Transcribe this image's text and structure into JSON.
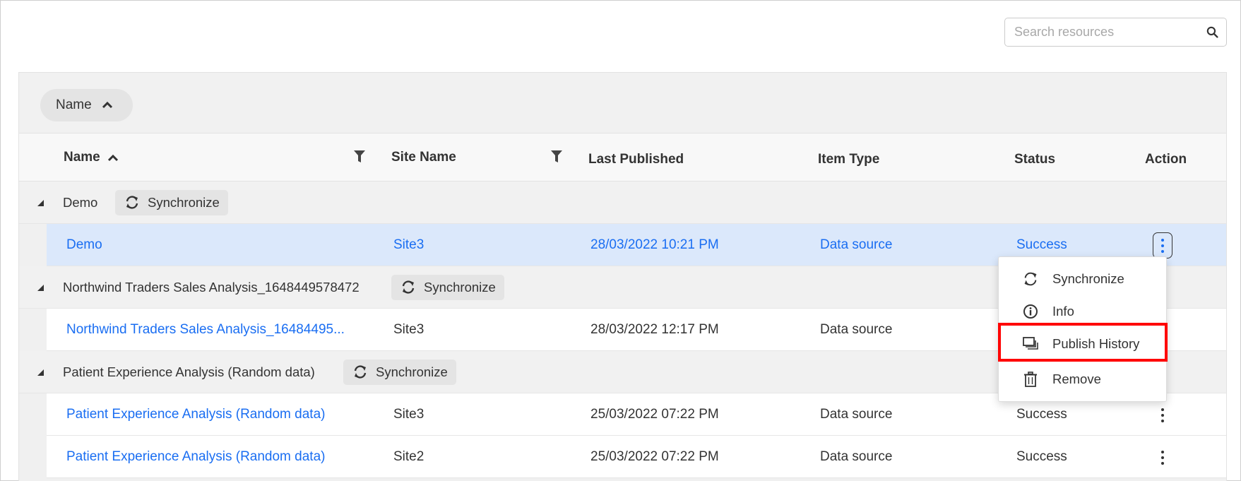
{
  "search": {
    "placeholder": "Search resources",
    "value": "",
    "icon": "search-icon"
  },
  "group_by": {
    "chip_label": "Name",
    "sort_icon": "chevron-up-icon"
  },
  "columns": [
    {
      "label": "Name",
      "sorted": "ascending",
      "filterable": true
    },
    {
      "label": "Site Name",
      "filterable": true
    },
    {
      "label": "Last Published"
    },
    {
      "label": "Item Type"
    },
    {
      "label": "Status"
    },
    {
      "label": "Action"
    }
  ],
  "groups": [
    {
      "name": "Demo",
      "sync_label": "Synchronize",
      "rows": [
        {
          "name": "Demo",
          "site": "Site3",
          "published": "28/03/2022 10:21 PM",
          "type": "Data source",
          "status": "Success",
          "selected": true
        }
      ]
    },
    {
      "name": "Northwind Traders Sales Analysis_1648449578472",
      "sync_label": "Synchronize",
      "rows": [
        {
          "name": "Northwind Traders Sales Analysis_16484495...",
          "site": "Site3",
          "published": "28/03/2022 12:17 PM",
          "type": "Data source",
          "status": ""
        }
      ]
    },
    {
      "name": "Patient Experience Analysis (Random data)",
      "sync_label": "Synchronize",
      "rows": [
        {
          "name": "Patient Experience Analysis (Random data)",
          "site": "Site3",
          "published": "25/03/2022 07:22 PM",
          "type": "Data source",
          "status": "Success"
        },
        {
          "name": "Patient Experience Analysis (Random data)",
          "site": "Site2",
          "published": "25/03/2022 07:22 PM",
          "type": "Data source",
          "status": "Success"
        }
      ]
    }
  ],
  "context_menu": {
    "items": [
      {
        "label": "Synchronize",
        "icon": "sync-icon"
      },
      {
        "label": "Info",
        "icon": "info-icon"
      },
      {
        "label": "Publish History",
        "icon": "publish-history-icon",
        "highlighted": true
      },
      {
        "label": "Remove",
        "icon": "trash-icon"
      }
    ]
  },
  "colors": {
    "link": "#1a6ef2",
    "selected_row": "#dbe8fb",
    "highlight": "#ff0000"
  }
}
